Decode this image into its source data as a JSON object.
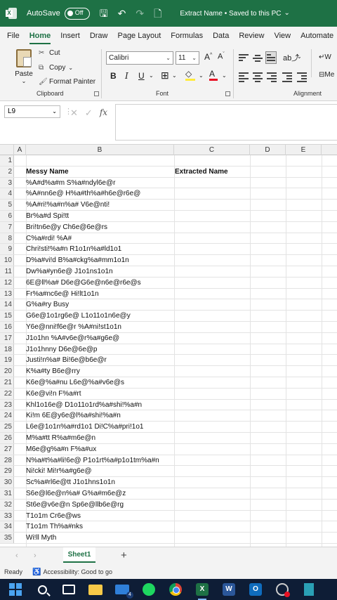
{
  "titlebar": {
    "autosave_label": "AutoSave",
    "toggle_state": "Off",
    "doc_title": "Extract Name • Saved to this PC",
    "chevron": "⌄"
  },
  "menu": {
    "tabs": [
      "File",
      "Home",
      "Insert",
      "Draw",
      "Page Layout",
      "Formulas",
      "Data",
      "Review",
      "View",
      "Automate"
    ],
    "active": "Home"
  },
  "ribbon": {
    "clipboard": {
      "paste": "Paste",
      "cut": "Cut",
      "copy": "Copy",
      "format_painter": "Format Painter",
      "group": "Clipboard"
    },
    "font": {
      "name": "Calibri",
      "size": "11",
      "group": "Font",
      "bold": "B",
      "italic": "I",
      "underline": "U",
      "grow": "A",
      "shrink": "A"
    },
    "alignment": {
      "group": "Alignment",
      "wrap_partial": "W",
      "merge_partial": "Me"
    }
  },
  "formula": {
    "name_box": "L9",
    "cancel": "✕",
    "enter": "✓",
    "fx": "fx",
    "value": ""
  },
  "columns": [
    "A",
    "B",
    "C",
    "D",
    "E"
  ],
  "rows": [
    {
      "n": "1",
      "b": "",
      "c": ""
    },
    {
      "n": "2",
      "b": "Messy Name",
      "c": "Extracted Name"
    },
    {
      "n": "3",
      "b": "%A#d%a#m S%a#ndyl6e@r",
      "c": ""
    },
    {
      "n": "4",
      "b": "%A#nn6e@ H%a#th%a#h6e@r6e@",
      "c": ""
    },
    {
      "n": "5",
      "b": "%A#ri!%a#n%a# V6e@nti!",
      "c": ""
    },
    {
      "n": "6",
      "b": "Br%a#d Spi!tt",
      "c": ""
    },
    {
      "n": "7",
      "b": "Bri!tn6e@y Ch6e@6e@rs",
      "c": ""
    },
    {
      "n": "8",
      "b": "C%a#rdi! %A#",
      "c": ""
    },
    {
      "n": "9",
      "b": "Chri!sti!%a#n R1o1n%a#ld1o1",
      "c": ""
    },
    {
      "n": "10",
      "b": "D%a#vi!d B%a#ckg%a#mm1o1n",
      "c": ""
    },
    {
      "n": "11",
      "b": "Dw%a#yn6e@ J1o1ns1o1n",
      "c": ""
    },
    {
      "n": "12",
      "b": "6E@ll%a# D6e@G6e@n6e@r6e@s",
      "c": ""
    },
    {
      "n": "13",
      "b": "Fr%a#nc6e@ Hi!lt1o1n",
      "c": ""
    },
    {
      "n": "14",
      "b": "G%a#ry Busy",
      "c": ""
    },
    {
      "n": "15",
      "b": "G6e@1o1rg6e@ L1o11o1n6e@y",
      "c": ""
    },
    {
      "n": "16",
      "b": "Y6e@nni!f6e@r %A#ni!st1o1n",
      "c": ""
    },
    {
      "n": "17",
      "b": "J1o1hn %A#v6e@r%a#g6e@",
      "c": ""
    },
    {
      "n": "18",
      "b": "J1o1hnny D6e@6e@p",
      "c": ""
    },
    {
      "n": "19",
      "b": "Justi!n%a# Bi!6e@b6e@r",
      "c": ""
    },
    {
      "n": "20",
      "b": "K%a#ty B6e@rry",
      "c": ""
    },
    {
      "n": "21",
      "b": "K6e@%a#nu L6e@%a#v6e@s",
      "c": ""
    },
    {
      "n": "22",
      "b": "K6e@vi!n F%a#rt",
      "c": ""
    },
    {
      "n": "23",
      "b": "Khl1o16e@ D1o11o1rd%a#shi!%a#n",
      "c": ""
    },
    {
      "n": "24",
      "b": "Ki!m 6E@y6e@l%a#shi!%a#n",
      "c": ""
    },
    {
      "n": "25",
      "b": "L6e@1o1n%a#rd1o1 Di!C%a#pri!1o1",
      "c": ""
    },
    {
      "n": "26",
      "b": "M%a#tt R%a#m6e@n",
      "c": ""
    },
    {
      "n": "27",
      "b": "M6e@g%a#n F%a#ux",
      "c": ""
    },
    {
      "n": "28",
      "b": "N%a#t%a#li!6e@ P1o1rt%a#p1o1tm%a#n",
      "c": ""
    },
    {
      "n": "29",
      "b": "Ni!cki! Mi!r%a#g6e@",
      "c": ""
    },
    {
      "n": "30",
      "b": "Sc%a#rl6e@tt J1o1hns1o1n",
      "c": ""
    },
    {
      "n": "31",
      "b": "S6e@l6e@n%a# G%a#m6e@z",
      "c": ""
    },
    {
      "n": "32",
      "b": "St6e@v6e@n Sp6e@llb6e@rg",
      "c": ""
    },
    {
      "n": "33",
      "b": "T1o1m Cr6e@ws",
      "c": ""
    },
    {
      "n": "34",
      "b": "T1o1m Th%a#nks",
      "c": ""
    },
    {
      "n": "35",
      "b": "Wi!ll Myth",
      "c": ""
    }
  ],
  "sheets": [
    "Sheet1"
  ],
  "status": {
    "ready": "Ready",
    "accessibility": "Accessibility: Good to go"
  },
  "taskbar": {
    "mail_badge": "4"
  },
  "colors": {
    "excel_green": "#1e7145",
    "taskbar": "#0e1d36"
  }
}
